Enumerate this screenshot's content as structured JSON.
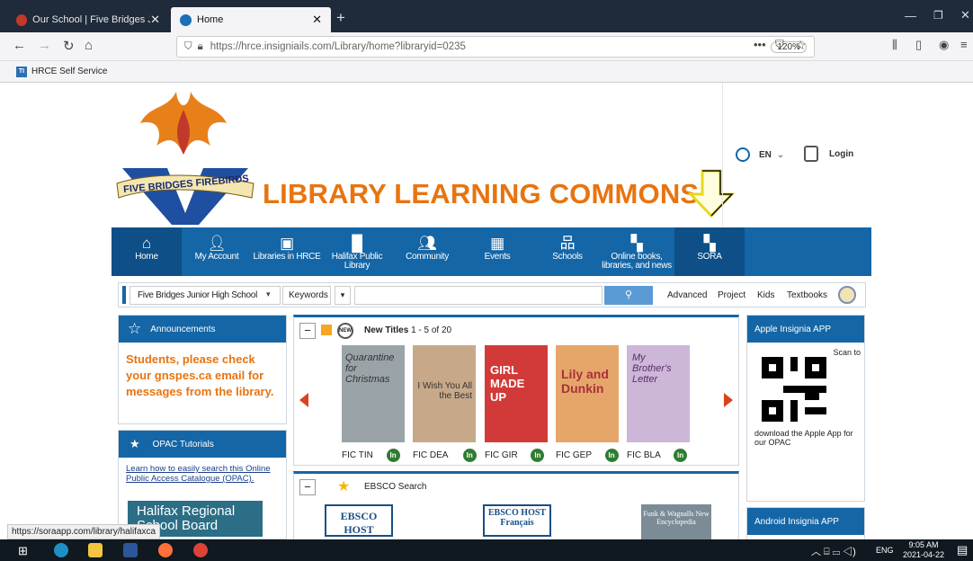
{
  "browser": {
    "tabs": [
      {
        "title": "Our School | Five Bridges Junio",
        "active": false
      },
      {
        "title": "Home",
        "active": true
      }
    ],
    "url": "https://hrce.insigniails.com/Library/home?libraryid=0235",
    "zoom": "120%",
    "bookmark": "HRCE Self Service",
    "status_url": "https://soraapp.com/library/halifaxca"
  },
  "header": {
    "school_logo_text": "FIVE BRIDGES FIREBIRDS",
    "title": "LIBRARY LEARNING COMMONS",
    "language": "EN",
    "login": "Login"
  },
  "menu": [
    {
      "label": "Home",
      "icon": "home-icon"
    },
    {
      "label": "My Account",
      "icon": "user-icon"
    },
    {
      "label": "Libraries in HRCE",
      "icon": "briefcase-icon"
    },
    {
      "label": "Halifax Public Library",
      "icon": "bar-chart-icon"
    },
    {
      "label": "Community",
      "icon": "people-icon"
    },
    {
      "label": "Events",
      "icon": "calendar-icon"
    },
    {
      "label": "Schools",
      "icon": "sitemap-icon"
    },
    {
      "label": "Online books, libraries, and news",
      "icon": "grid-icon"
    },
    {
      "label": "SORA",
      "icon": "grid-icon"
    }
  ],
  "search": {
    "library_select": "Five Bridges Junior High School",
    "field_select": "Keywords",
    "query": "",
    "links": [
      "Advanced",
      "Project",
      "Kids",
      "Textbooks"
    ]
  },
  "announcements": {
    "title": "Announcements",
    "message": "Students, please check your gnspes.ca email for messages from the library."
  },
  "opac": {
    "title": "OPAC Tutorials",
    "link": "Learn how to easily search this Online Public Access Catalogue (OPAC).",
    "banner": "Halifax Regional School Board"
  },
  "new_titles": {
    "title": "New Titles",
    "range": "1 - 5 of 20",
    "books": [
      {
        "call": "FIC TIN",
        "status": "In",
        "cover_text": "Quarantine for Christmas",
        "color": "#9aa4a8"
      },
      {
        "call": "FIC DEA",
        "status": "In",
        "cover_text": "I Wish You All the Best",
        "color": "#c7a98a"
      },
      {
        "call": "FIC GIR",
        "status": "In",
        "cover_text": "GIRL MADE UP",
        "color": "#d23a3a"
      },
      {
        "call": "FIC GEP",
        "status": "In",
        "cover_text": "Lily and Dunkin",
        "color": "#e6a66a"
      },
      {
        "call": "FIC BLA",
        "status": "In",
        "cover_text": "My Brother's Letter",
        "color": "#cdb7d8"
      }
    ]
  },
  "ebsco": {
    "title": "EBSCO Search",
    "logos": [
      "EBSCO HOST",
      "EBSCO HOST Français",
      "Funk & Wagnalls New Encyclopedia"
    ]
  },
  "apple_app": {
    "title": "Apple Insignia APP",
    "scan": "Scan to",
    "caption": "download the Apple App for our OPAC"
  },
  "android_app": {
    "title": "Android Insignia APP"
  },
  "taskbar": {
    "lang": "ENG",
    "time": "9:05 AM",
    "date": "2021-04-22"
  }
}
